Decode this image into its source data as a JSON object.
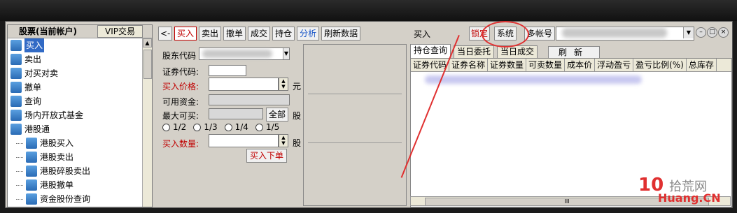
{
  "left_panel": {
    "tab_account": "股票(当前帐户)",
    "tab_vip": "VIP交易",
    "items": [
      {
        "label": "买入",
        "icon": "buy-icon",
        "selected": true,
        "child": false
      },
      {
        "label": "卖出",
        "icon": "sell-icon",
        "selected": false,
        "child": false
      },
      {
        "label": "对买对卖",
        "icon": "swap-icon",
        "selected": false,
        "child": false
      },
      {
        "label": "撤单",
        "icon": "cancel-order-icon",
        "selected": false,
        "child": false
      },
      {
        "label": "查询",
        "icon": "query-icon",
        "selected": false,
        "child": false
      },
      {
        "label": "场内开放式基金",
        "icon": "fund-icon",
        "selected": false,
        "child": false
      },
      {
        "label": "港股通",
        "icon": "hk-connect-icon",
        "selected": false,
        "child": false
      },
      {
        "label": "港股买入",
        "icon": "buy-icon",
        "selected": false,
        "child": true
      },
      {
        "label": "港股卖出",
        "icon": "sell-icon",
        "selected": false,
        "child": true
      },
      {
        "label": "港股碎股卖出",
        "icon": "sell-icon",
        "selected": false,
        "child": true
      },
      {
        "label": "港股撤单",
        "icon": "cancel-order-icon",
        "selected": false,
        "child": true
      },
      {
        "label": "资金股份查询",
        "icon": "query-icon",
        "selected": false,
        "child": true
      }
    ]
  },
  "toolbar": {
    "back": "<-",
    "buttons": [
      {
        "label": "买入",
        "style": "red"
      },
      {
        "label": "卖出",
        "style": ""
      },
      {
        "label": "撤单",
        "style": ""
      },
      {
        "label": "成交",
        "style": ""
      },
      {
        "label": "持仓",
        "style": ""
      },
      {
        "label": "分析",
        "style": "blue"
      },
      {
        "label": "刷新数据",
        "style": ""
      }
    ],
    "title": "买入",
    "lock": "锁定",
    "system": "系统",
    "multi_account": "多帐号"
  },
  "form": {
    "holder_code_label": "股东代码",
    "stock_code_label": "证券代码:",
    "buy_price_label": "买入价格:",
    "price_unit": "元",
    "available_funds_label": "可用资金:",
    "max_buy_label": "最大可买:",
    "all_button": "全部",
    "share_unit": "股",
    "ratios": [
      "1/2",
      "1/3",
      "1/4",
      "1/5"
    ],
    "buy_qty_label": "买入数量:",
    "qty_unit": "股",
    "submit": "买入下单"
  },
  "tabs": {
    "positions": "持仓查询",
    "today_orders": "当日委托",
    "today_trades": "当日成交",
    "refresh": "刷新"
  },
  "table": {
    "columns": [
      "证券代码",
      "证券名称",
      "证券数量",
      "可卖数量",
      "成本价",
      "浮动盈亏",
      "盈亏比例(%)",
      "总库存"
    ]
  },
  "scroll_text": "III",
  "watermark": {
    "brand": "10",
    "cn": "拾荒网",
    "url": "Huang.CN"
  },
  "colors": {
    "accent_red": "#c00000",
    "select_blue": "#316ac5",
    "annotation_red": "#e03030"
  }
}
